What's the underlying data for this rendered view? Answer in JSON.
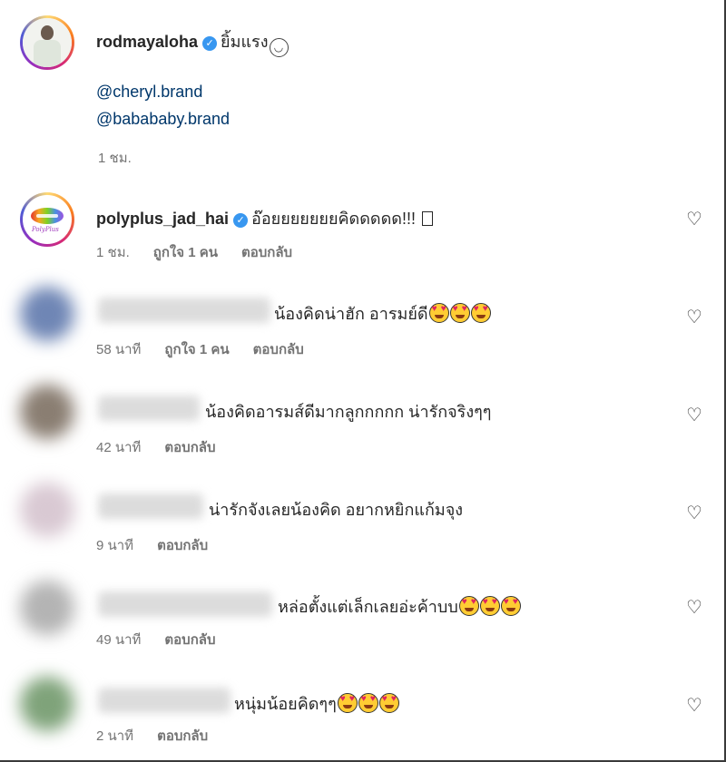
{
  "caption": {
    "username": "rodmayaloha",
    "verified_icon": "verified-badge-icon",
    "text": "ยิ้มแรง",
    "emoji": "grinning-face-icon",
    "mentions": [
      "@cheryl.brand",
      "@babababy.brand"
    ],
    "time": "1 ชม."
  },
  "comments": [
    {
      "username": "polyplus_jad_hai",
      "verified": true,
      "text": "อ๊อยยยยยยยคิดดดดด!!!",
      "time": "1 ชม.",
      "likes": "ถูกใจ 1 คน",
      "reply": "ตอบกลับ"
    },
    {
      "username": "",
      "text": "น้องคิดน่าฮัก อารมย์ดี",
      "emoji_count": 3,
      "time": "58 นาที",
      "likes": "ถูกใจ 1 คน",
      "reply": "ตอบกลับ"
    },
    {
      "username": "",
      "text": "น้องคิดอารมส์ดีมากลูกกกกก น่ารักจริงๆๆ",
      "time": "42 นาที",
      "reply": "ตอบกลับ"
    },
    {
      "username": "",
      "text": "น่ารักจังเลยน้องคิด อยากหยิกแก้มจุง",
      "time": "9 นาที",
      "reply": "ตอบกลับ"
    },
    {
      "username": "",
      "text": "หล่อตั้งแต่เล็กเลยอ่ะค้าบบ",
      "emoji_count": 3,
      "time": "49 นาที",
      "reply": "ตอบกลับ"
    },
    {
      "username": "",
      "text": "หนุ่มน้อยคิดๆๆ",
      "emoji_count": 3,
      "time": "2 นาที",
      "reply": "ตอบกลับ"
    }
  ],
  "icons": {
    "like": "heart-outline-icon",
    "emoji": "smiling-face-with-heart-eyes-icon"
  },
  "colors": {
    "link": "#00376b",
    "verified": "#3897f0",
    "meta": "#737373"
  }
}
